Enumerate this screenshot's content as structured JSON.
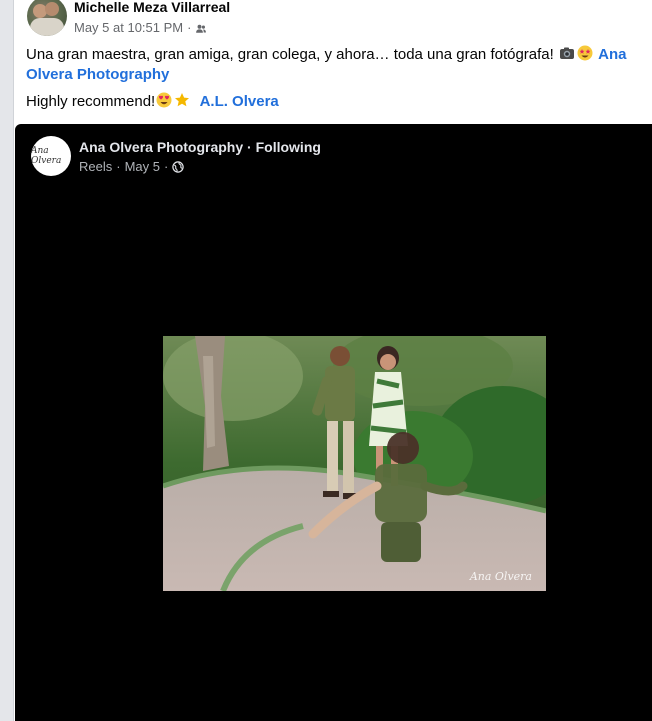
{
  "post": {
    "author": "Michelle Meza Villarreal",
    "timestamp": "May 5 at 10:51 PM",
    "separator": "·",
    "audience_icon": "friends-icon",
    "text_line1_prefix": "Una gran maestra, gran amiga, gran colega, y ahora… toda una gran fotógrafa! ",
    "text_line1_emoji": [
      "camera-emoji",
      "star-struck-emoji"
    ],
    "mention_1": "Ana Olvera Photography",
    "text_line2_prefix": "Highly recommend!",
    "text_line2_emoji": [
      "heart-eyes-emoji",
      "star-emoji"
    ],
    "mention_2": "A.L. Olvera"
  },
  "shared_reel": {
    "page_name": "Ana Olvera Photography",
    "follow_status": "Following",
    "title_separator": " · ",
    "type": "Reels",
    "date": "May 5",
    "separator": "·",
    "privacy_icon": "globe-icon",
    "avatar_logo_text": "Ana Olvera",
    "watermark": "Ana Olvera"
  },
  "colors": {
    "link": "#216fdb",
    "reel_background": "#000000",
    "secondary_text": "#65676b"
  }
}
